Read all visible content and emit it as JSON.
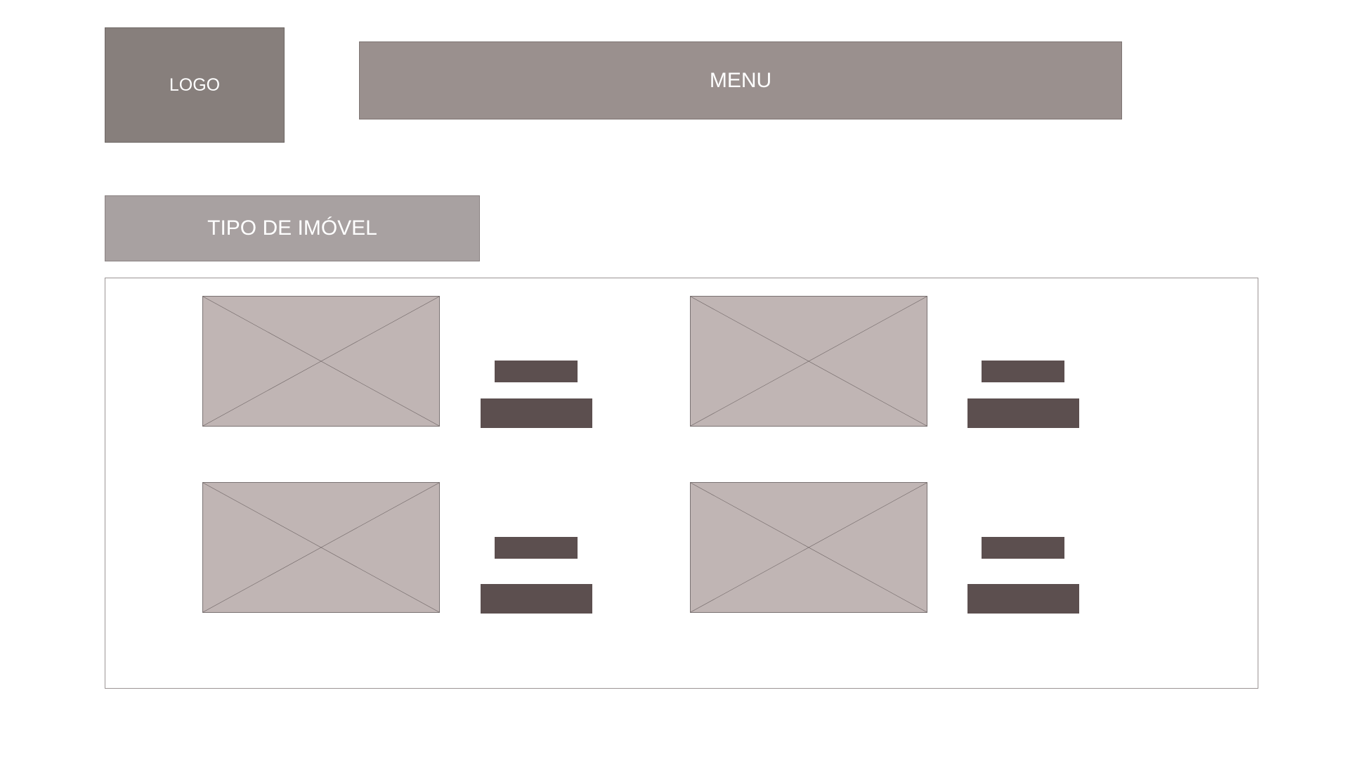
{
  "header": {
    "logo_label": "LOGO",
    "menu_label": "MENU"
  },
  "filter": {
    "property_type_label": "TIPO DE IMÓVEL"
  },
  "listings": [
    {
      "image_icon": "image-placeholder-icon"
    },
    {
      "image_icon": "image-placeholder-icon"
    },
    {
      "image_icon": "image-placeholder-icon"
    },
    {
      "image_icon": "image-placeholder-icon"
    }
  ],
  "colors": {
    "logo_bg": "#877f7c",
    "menu_bg": "#9a908e",
    "filter_bg": "#a8a1a1",
    "image_placeholder": "#c0b5b4",
    "text_bar": "#5c4f4f"
  }
}
